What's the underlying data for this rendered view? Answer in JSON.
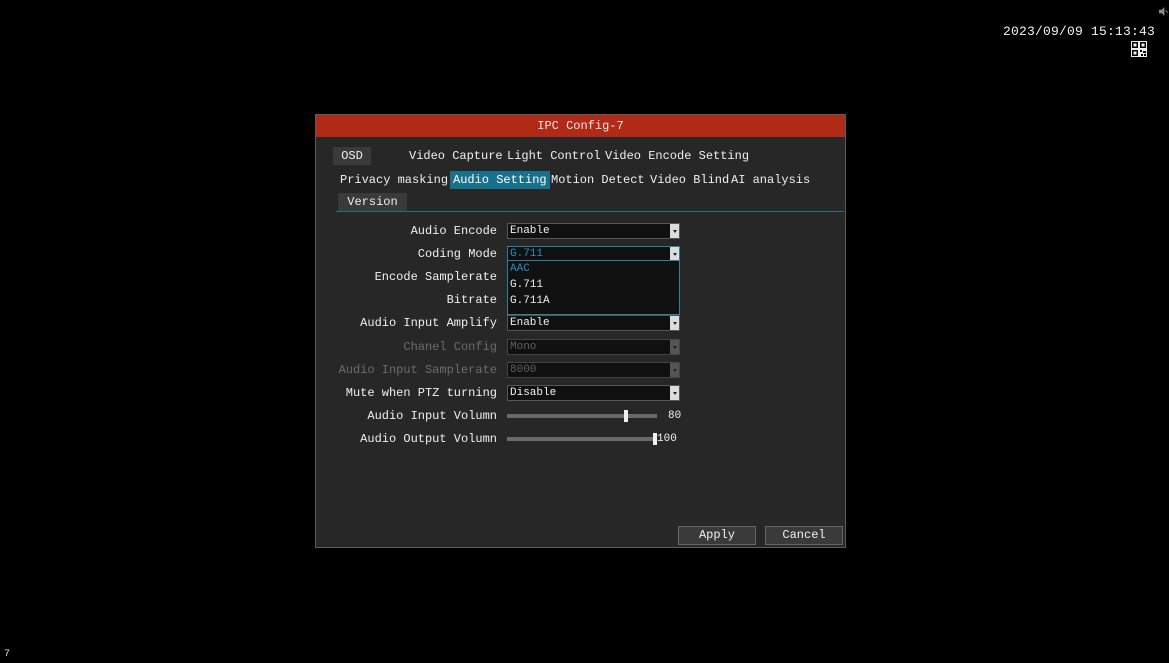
{
  "screen": {
    "datetime": "2023/09/09 15:13:43",
    "channel_number": "7"
  },
  "dialog": {
    "title": "IPC Config-7",
    "tabs": [
      {
        "label": "OSD",
        "active": false
      },
      {
        "label": "Video Capture",
        "active": false
      },
      {
        "label": "Light Control",
        "active": false
      },
      {
        "label": "Video Encode Setting",
        "active": false
      },
      {
        "label": "Privacy masking",
        "active": false
      },
      {
        "label": "Audio Setting",
        "active": true
      },
      {
        "label": "Motion Detect",
        "active": false
      },
      {
        "label": "Video Blind",
        "active": false
      },
      {
        "label": "AI analysis",
        "active": false
      },
      {
        "label": "Version",
        "active": false
      }
    ],
    "fields": {
      "audio_encode": {
        "label": "Audio Encode",
        "value": "Enable"
      },
      "coding_mode": {
        "label": "Coding Mode",
        "value": "G.711",
        "options": [
          "AAC",
          "G.711",
          "G.711A"
        ],
        "highlighted_option": "AAC"
      },
      "encode_samplerate": {
        "label": "Encode Samplerate"
      },
      "bitrate": {
        "label": "Bitrate"
      },
      "audio_input_amplify": {
        "label": "Audio Input Amplify",
        "value": "Enable"
      },
      "chanel_config": {
        "label": "Chanel Config",
        "value": "Mono",
        "disabled": true
      },
      "audio_input_samplerate": {
        "label": "Audio Input Samplerate",
        "value": "8000",
        "disabled": true
      },
      "mute_ptz": {
        "label": "Mute when PTZ turning",
        "value": "Disable"
      },
      "audio_input_volumn": {
        "label": "Audio Input Volumn",
        "value": "80",
        "level": 80
      },
      "audio_output_volumn": {
        "label": "Audio Output Volumn",
        "value": "100",
        "level": 100
      }
    },
    "buttons": {
      "apply": "Apply",
      "cancel": "Cancel"
    }
  },
  "colors": {
    "title_bar": "#b12a18",
    "active_tab": "#17708c",
    "dialog_bg": "#272727",
    "dropdown_selected": "#2b8fb5"
  }
}
